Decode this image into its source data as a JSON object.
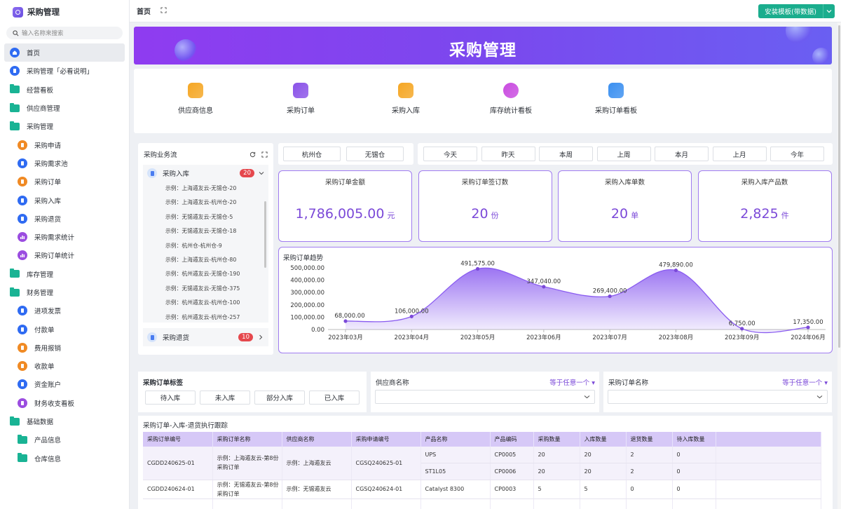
{
  "app": {
    "title": "采购管理"
  },
  "search": {
    "placeholder": "输入名称来搜索"
  },
  "nav": [
    {
      "label": "首页",
      "icon": "home-icon",
      "color": "#2f6bf2",
      "level": 0,
      "active": true
    },
    {
      "label": "采购管理「必看说明」",
      "icon": "doc-icon",
      "color": "#2f6bf2",
      "level": 0
    },
    {
      "label": "经营看板",
      "icon": "folder-icon",
      "color": "#19b394",
      "level": 0
    },
    {
      "label": "供应商管理",
      "icon": "folder-icon",
      "color": "#19b394",
      "level": 0
    },
    {
      "label": "采购管理",
      "icon": "folder-icon",
      "color": "#19b394",
      "level": 0
    },
    {
      "label": "采购申请",
      "icon": "form-icon",
      "color": "#f08a24",
      "level": 1
    },
    {
      "label": "采购需求池",
      "icon": "form-icon",
      "color": "#2f6bf2",
      "level": 1
    },
    {
      "label": "采购订单",
      "icon": "form-icon",
      "color": "#f08a24",
      "level": 1
    },
    {
      "label": "采购入库",
      "icon": "form-icon",
      "color": "#2f6bf2",
      "level": 1
    },
    {
      "label": "采购退货",
      "icon": "form-icon",
      "color": "#2f6bf2",
      "level": 1
    },
    {
      "label": "采购需求统计",
      "icon": "chart-icon",
      "color": "#9b4de0",
      "level": 1
    },
    {
      "label": "采购订单统计",
      "icon": "chart-icon",
      "color": "#9b4de0",
      "level": 1
    },
    {
      "label": "库存管理",
      "icon": "folder-icon",
      "color": "#19b394",
      "level": 0
    },
    {
      "label": "财务管理",
      "icon": "folder-icon",
      "color": "#19b394",
      "level": 0
    },
    {
      "label": "进项发票",
      "icon": "form-icon",
      "color": "#2f6bf2",
      "level": 1
    },
    {
      "label": "付款单",
      "icon": "form-icon",
      "color": "#2f6bf2",
      "level": 1
    },
    {
      "label": "费用报销",
      "icon": "card-icon",
      "color": "#f08a24",
      "level": 1
    },
    {
      "label": "收款单",
      "icon": "form-icon",
      "color": "#f08a24",
      "level": 1
    },
    {
      "label": "资金账户",
      "icon": "form-icon",
      "color": "#2f6bf2",
      "level": 1
    },
    {
      "label": "财务收支看板",
      "icon": "board-icon",
      "color": "#9b4de0",
      "level": 1
    },
    {
      "label": "基础数据",
      "icon": "folder-icon",
      "color": "#19b394",
      "level": 0
    },
    {
      "label": "产品信息",
      "icon": "folder-icon",
      "color": "#19b394",
      "level": 1
    },
    {
      "label": "仓库信息",
      "icon": "folder-icon",
      "color": "#19b394",
      "level": 1
    }
  ],
  "topbar": {
    "tab": "首页",
    "template_button": "安装模板(带数据)"
  },
  "banner": {
    "title": "采购管理"
  },
  "quick": [
    {
      "label": "供应商信息",
      "color": "#f5a623"
    },
    {
      "label": "采购订单",
      "color": "#8a52e8"
    },
    {
      "label": "采购入库",
      "color": "#f5a623"
    },
    {
      "label": "库存统计看板",
      "color": "#c94be0"
    },
    {
      "label": "采购订单看板",
      "color": "#3a8ff0"
    }
  ],
  "flow": {
    "title": "采购业务流",
    "inbound": {
      "label": "采购入库",
      "count": "20"
    },
    "items": [
      "示例：上海遁友云-无锡仓-20",
      "示例：上海遁友云-杭州仓-20",
      "示例：无锡遁友云-无锡仓-5",
      "示例：无锡遁友云-无锡仓-18",
      "示例：杭州仓-杭州仓-9",
      "示例：上海遁友云-杭州仓-80",
      "示例：杭州遁友云-无锡仓-190",
      "示例：无锡遁友云-无锡仓-375",
      "示例：杭州遁友云-杭州仓-100",
      "示例：杭州遁友云-杭州仓-257"
    ],
    "returns": {
      "label": "采购退货",
      "count": "10"
    }
  },
  "warehouses": [
    "杭州仓",
    "无锡仓"
  ],
  "periods": [
    "今天",
    "昨天",
    "本周",
    "上周",
    "本月",
    "上月",
    "今年"
  ],
  "kpis": [
    {
      "title": "采购订单金额",
      "value": "1,786,005.00",
      "unit": "元"
    },
    {
      "title": "采购订单签订数",
      "value": "20",
      "unit": "份"
    },
    {
      "title": "采购入库单数",
      "value": "20",
      "unit": "单"
    },
    {
      "title": "采购入库产品数",
      "value": "2,825",
      "unit": "件"
    }
  ],
  "trend_title": "采购订单趋势",
  "chart_data": {
    "type": "area",
    "categories": [
      "2023年03月",
      "2023年04月",
      "2023年05月",
      "2023年06月",
      "2023年07月",
      "2023年08月",
      "2023年09月",
      "2024年06月"
    ],
    "values": [
      68000,
      106000,
      491575,
      347040,
      269400,
      479890,
      6750,
      17350
    ],
    "value_labels": [
      "68,000.00",
      "106,000.00",
      "491,575.00",
      "347,040.00",
      "269,400.00",
      "479,890.00",
      "6,750.00",
      "17,350.00"
    ],
    "yticks": [
      "0.00",
      "100,000.00",
      "200,000.00",
      "300,000.00",
      "400,000.00",
      "500,000.00"
    ],
    "ylim": [
      0,
      500000
    ],
    "color": "#8a5cf0"
  },
  "tags": {
    "title": "采购订单标签",
    "items": [
      "待入库",
      "未入库",
      "部分入库",
      "已入库"
    ]
  },
  "filters": [
    {
      "label": "供应商名称",
      "op": "等于任意一个"
    },
    {
      "label": "采购订单名称",
      "op": "等于任意一个"
    }
  ],
  "table": {
    "title": "采购订单-入库-退货执行跟踪",
    "columns": [
      "采购订单编号",
      "采购订单名称",
      "供应商名称",
      "采购申请编号",
      "产品名称",
      "产品编码",
      "采购数量",
      "入库数量",
      "退货数量",
      "待入库数量"
    ],
    "rows": [
      {
        "order": "CGDD240625-01",
        "name": "示例：上海遁友云-第8份采购订单",
        "supplier": "示例：上海遁友云",
        "req": "CGSQ240625-01",
        "products": [
          [
            "UPS",
            "CP0005",
            "20",
            "20",
            "2",
            "0"
          ],
          [
            "ST1L05",
            "CP0006",
            "20",
            "20",
            "2",
            "0"
          ]
        ]
      },
      {
        "order": "CGDD240624-01",
        "name": "示例：无锡遁友云-第8份采购订单",
        "supplier": "示例：无锡遁友云",
        "req": "CGSQ240624-01",
        "products": [
          [
            "Catalyst 8300",
            "CP0003",
            "5",
            "5",
            "0",
            "0"
          ]
        ]
      }
    ]
  }
}
